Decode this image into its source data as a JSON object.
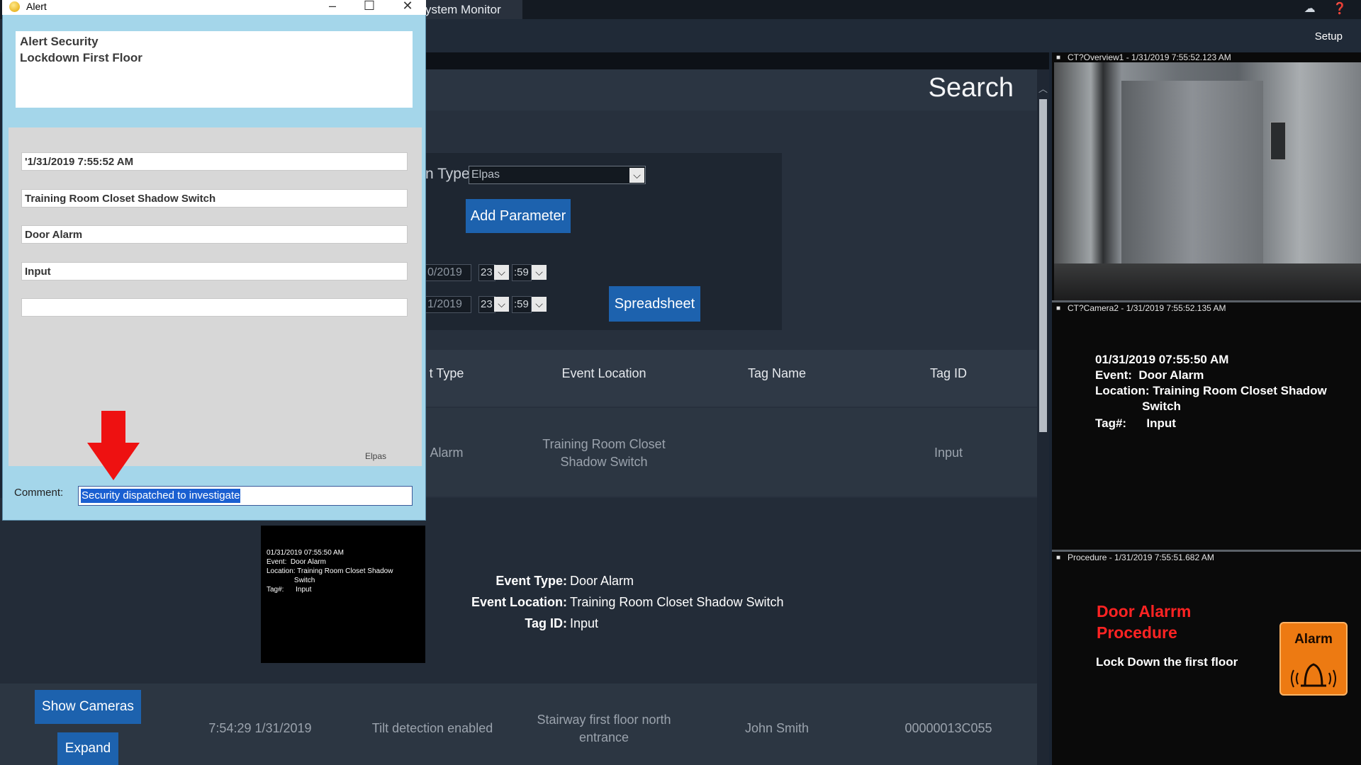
{
  "app": {
    "main_tab": "ystem Monitor",
    "tray_icons": "☁ ❓",
    "setup": "Setup"
  },
  "search": {
    "title": "Search",
    "type_label": "n Type",
    "type_value": "Elpas",
    "add_parameter": "Add Parameter",
    "spreadsheet": "Spreadsheet",
    "start": {
      "date": "0/2019",
      "hour": "23",
      "minute": ":59"
    },
    "end": {
      "date": "1/2019",
      "hour": "23",
      "minute": ":59"
    }
  },
  "table": {
    "headers": [
      "t Type",
      "Event Location",
      "Tag Name",
      "Tag ID"
    ],
    "row1": {
      "type": "Alarm",
      "location": "Training Room Closet Shadow Switch",
      "tag_id": "Input"
    },
    "detail": {
      "thumb_lines": [
        "01/31/2019 07:55:50 AM",
        "Event:  Door Alarm",
        "Location: Training Room Closet Shadow",
        "              Switch",
        "Tag#:      Input"
      ],
      "event_type_label": "Event Type:",
      "event_type": "Door Alarm",
      "event_location_label": "Event Location:",
      "event_location": "Training Room Closet Shadow Switch",
      "tag_id_label": "Tag ID:",
      "tag_id": "Input"
    },
    "row2": {
      "time": "7:54:29 1/31/2019",
      "type": "Tilt detection enabled",
      "location": "Stairway first floor north entrance",
      "tag_name": "John Smith",
      "tag_id": "00000013C055"
    },
    "show_cameras": "Show Cameras",
    "expand": "Expand"
  },
  "cameras": {
    "cam1_caption": "CT?Overview1 - 1/31/2019 7:55:52.123 AM",
    "cam2_caption": "CT?Camera2 - 1/31/2019 7:55:52.135 AM",
    "cam2_lines": [
      "01/31/2019 07:55:50 AM",
      "Event:  Door Alarm",
      "Location: Training Room Closet Shadow",
      "              Switch",
      "Tag#:      Input"
    ],
    "proc_caption": "Procedure - 1/31/2019 7:55:51.682 AM",
    "proc_title_1": "Door Alarrm",
    "proc_title_2": "Procedure",
    "proc_text": "Lock Down the first floor",
    "alarm_badge": "Alarm"
  },
  "alert": {
    "title": "Alert",
    "minimize": "–",
    "maximize": "☐",
    "close": "✕",
    "message_1": "Alert Security",
    "message_2": "Lockdown First Floor",
    "fields": [
      "'1/31/2019 7:55:52 AM",
      "Training Room Closet Shadow Switch",
      "Door Alarm",
      "Input",
      ""
    ],
    "source": "Elpas",
    "comment_label": "Comment:",
    "comment_value": "Security dispatched to investigate"
  },
  "colors": {
    "accent_button": "#1d62ae",
    "alert_bg": "#a4d6ea",
    "procedure_red": "#ff2323",
    "alarm_orange": "#ed7a12",
    "arrow_red": "#ee1111"
  }
}
